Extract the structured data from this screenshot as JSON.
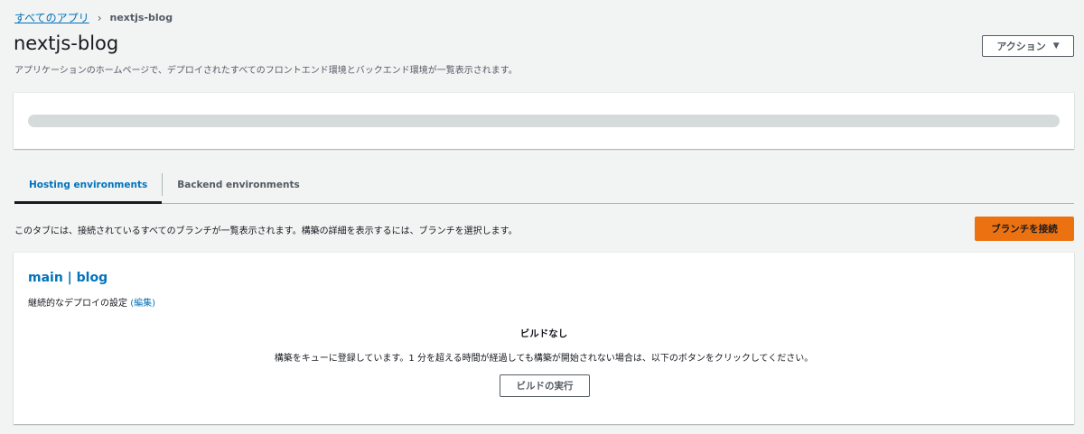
{
  "breadcrumb": {
    "root_label": "すべてのアプリ",
    "separator": "›",
    "current": "nextjs-blog"
  },
  "header": {
    "title": "nextjs-blog",
    "actions_label": "アクション",
    "actions_icon": "caret-down-icon",
    "description": "アプリケーションのホームページで、デプロイされたすべてのフロントエンド環境とバックエンド環境が一覧表示されます。"
  },
  "tabs": [
    {
      "label": "Hosting environments",
      "active": true
    },
    {
      "label": "Backend environments",
      "active": false
    }
  ],
  "hosting": {
    "description": "このタブには、接続されているすべてのブランチが一覧表示されます。構築の詳細を表示するには、ブランチを選択します。",
    "connect_branch_label": "ブランチを接続"
  },
  "branch_card": {
    "title": "main | blog",
    "deploy_setting_label": "継続的なデプロイの設定",
    "edit_link": "(編集)",
    "no_build_title": "ビルドなし",
    "queue_message": "構築をキューに登録しています。1 分を超える時間が経過しても構築が開始されない場合は、以下のボタンをクリックしてください。",
    "run_build_label": "ビルドの実行"
  },
  "colors": {
    "link": "#0073bb",
    "primary_button": "#ec7211",
    "background": "#f2f3f3"
  }
}
